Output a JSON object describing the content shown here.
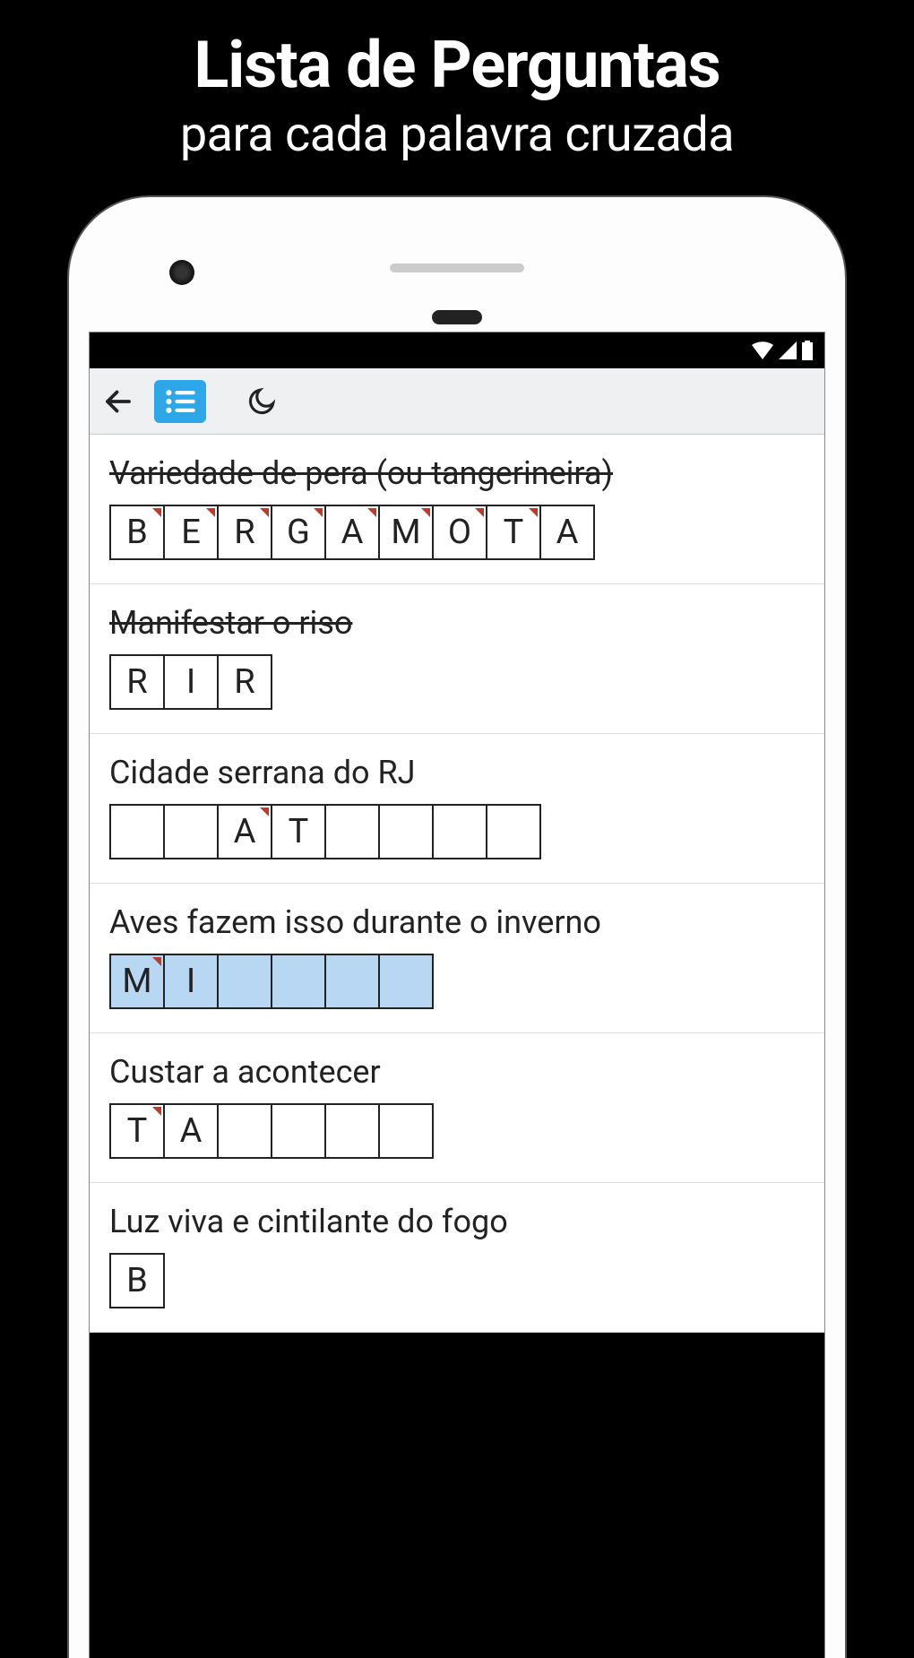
{
  "promo": {
    "title": "Lista de Perguntas",
    "subtitle": "para cada palavra cruzada"
  },
  "toolbar": {
    "back_icon": "back-arrow-icon",
    "list_icon": "list-icon",
    "moon_icon": "moon-icon"
  },
  "clues": [
    {
      "text": "Variedade de pera (ou tangerineira)",
      "completed": true,
      "active": false,
      "cells": [
        {
          "letter": "B",
          "tick": true
        },
        {
          "letter": "E",
          "tick": true
        },
        {
          "letter": "R",
          "tick": true
        },
        {
          "letter": "G",
          "tick": true
        },
        {
          "letter": "A",
          "tick": true
        },
        {
          "letter": "M",
          "tick": true
        },
        {
          "letter": "O",
          "tick": true
        },
        {
          "letter": "T",
          "tick": true
        },
        {
          "letter": "A",
          "tick": false
        }
      ]
    },
    {
      "text": "Manifestar o riso",
      "completed": true,
      "active": false,
      "cells": [
        {
          "letter": "R",
          "tick": false
        },
        {
          "letter": "I",
          "tick": false
        },
        {
          "letter": "R",
          "tick": false
        }
      ]
    },
    {
      "text": "Cidade serrana do RJ",
      "completed": false,
      "active": false,
      "cells": [
        {
          "letter": "",
          "tick": false
        },
        {
          "letter": "",
          "tick": false
        },
        {
          "letter": "A",
          "tick": true
        },
        {
          "letter": "T",
          "tick": false
        },
        {
          "letter": "",
          "tick": false
        },
        {
          "letter": "",
          "tick": false
        },
        {
          "letter": "",
          "tick": false
        },
        {
          "letter": "",
          "tick": false
        }
      ]
    },
    {
      "text": "Aves fazem isso durante o inverno",
      "completed": false,
      "active": true,
      "cells": [
        {
          "letter": "M",
          "tick": true
        },
        {
          "letter": "I",
          "tick": false
        },
        {
          "letter": "",
          "tick": false
        },
        {
          "letter": "",
          "tick": false
        },
        {
          "letter": "",
          "tick": false
        },
        {
          "letter": "",
          "tick": false
        }
      ]
    },
    {
      "text": "Custar a acontecer",
      "completed": false,
      "active": false,
      "cells": [
        {
          "letter": "T",
          "tick": true
        },
        {
          "letter": "A",
          "tick": false
        },
        {
          "letter": "",
          "tick": false
        },
        {
          "letter": "",
          "tick": false
        },
        {
          "letter": "",
          "tick": false
        },
        {
          "letter": "",
          "tick": false
        }
      ]
    },
    {
      "text": "Luz viva e cintilante do fogo",
      "completed": false,
      "active": false,
      "cells": [
        {
          "letter": "B",
          "tick": false
        }
      ]
    }
  ]
}
